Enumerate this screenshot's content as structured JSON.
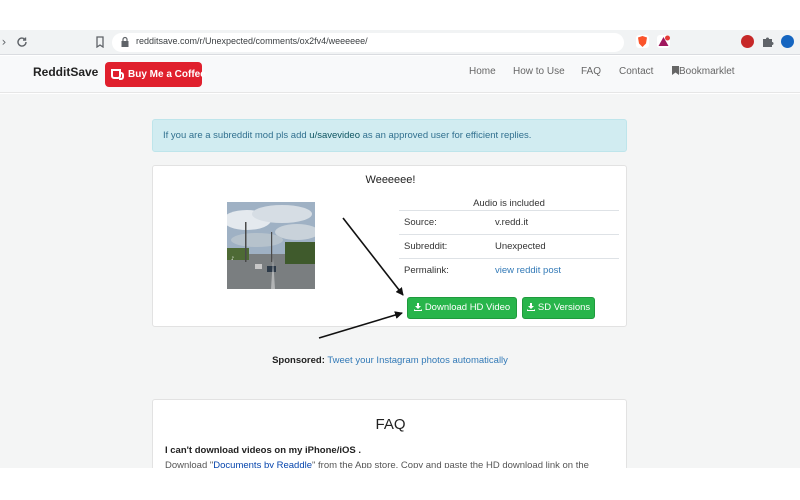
{
  "browser": {
    "url": "redditsave.com/r/Unexpected/comments/ox2fv4/weeeeee/",
    "back_icon": "chevron-left-icon",
    "reload_icon": "reload-icon",
    "bookmark_icon": "bookmark-icon"
  },
  "site": {
    "brand": "RedditSave",
    "coffee_button": "Buy Me a Coffee",
    "nav": [
      "Home",
      "How to Use",
      "FAQ",
      "Contact",
      "Bookmarklet"
    ]
  },
  "alert": {
    "text_before": "If you are a subreddit mod pls add ",
    "link": "u/savevideo",
    "text_after": " as an approved user for efficient replies."
  },
  "post": {
    "title": "Weeeeee!",
    "audio_note": "Audio is included",
    "rows": [
      {
        "key": "Source:",
        "value": "v.redd.it"
      },
      {
        "key": "Subreddit:",
        "value": "Unexpected"
      },
      {
        "key": "Permalink:",
        "value": "view reddit post"
      }
    ],
    "download_hd": "Download HD Video",
    "sd_versions": "SD Versions"
  },
  "sponsored": {
    "label": "Sponsored:",
    "link": "Tweet your Instagram photos automatically"
  },
  "faq": {
    "title": "FAQ",
    "question": "I can't download videos on my iPhone/iOS .",
    "answer_before": "Download \"",
    "answer_link": "Documents by Readdle",
    "answer_after": "\" from the App store. Copy and paste the HD download link on the"
  },
  "colors": {
    "brand_red": "#e0202d",
    "button_green": "#28b54b",
    "alert_bg": "#d1ecf1",
    "link_blue": "#337ab7"
  }
}
